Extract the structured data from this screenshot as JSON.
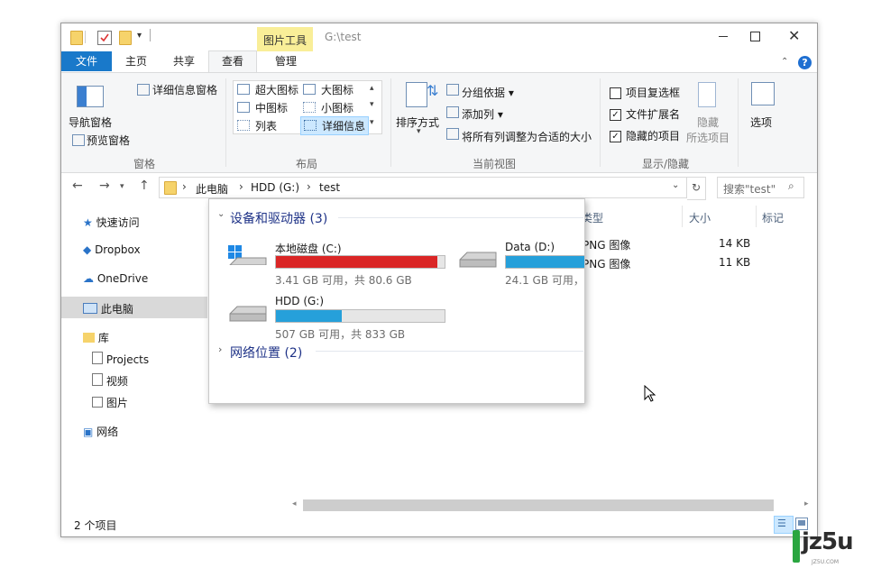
{
  "window": {
    "contextual_tab": "图片工具",
    "path_title": "G:\\test",
    "tabs": [
      "文件",
      "主页",
      "共享",
      "查看",
      "管理"
    ]
  },
  "ribbon": {
    "pane": {
      "nav_pane": "导航窗格",
      "preview_pane": "预览窗格",
      "details_pane": "详细信息窗格",
      "group": "窗格"
    },
    "layout": {
      "items": [
        "超大图标",
        "大图标",
        "中图标",
        "小图标",
        "列表",
        "详细信息"
      ],
      "group": "布局"
    },
    "current_view": {
      "sort": "排序方式",
      "group_by": "分组依据",
      "add_columns": "添加列",
      "fit_columns": "将所有列调整为合适的大小",
      "group": "当前视图"
    },
    "show_hide": {
      "item_checkboxes": "项目复选框",
      "file_extensions": "文件扩展名",
      "hidden_items": "隐藏的项目",
      "hide_selected": "隐藏",
      "hide_selected_2": "所选项目",
      "group": "显示/隐藏"
    },
    "options": "选项"
  },
  "address": {
    "crumbs": [
      "此电脑",
      "HDD (G:)",
      "test"
    ],
    "search_placeholder": "搜索\"test\""
  },
  "nav": {
    "quick_access": "快速访问",
    "dropbox": "Dropbox",
    "onedrive": "OneDrive",
    "this_pc": "此电脑",
    "libraries": "库",
    "projects": "Projects",
    "videos": "视频",
    "pictures": "图片",
    "network": "网络"
  },
  "columns": {
    "type": "类型",
    "size": "大小",
    "tags": "标记"
  },
  "files": [
    {
      "type": "PNG 图像",
      "size": "14 KB"
    },
    {
      "type": "PNG 图像",
      "size": "11 KB"
    }
  ],
  "dropdown": {
    "devices_header": "设备和驱动器 (3)",
    "network_header": "网络位置 (2)",
    "drives": [
      {
        "name": "本地磁盘 (C:)",
        "info": "3.41 GB 可用，共 80.6 GB",
        "used": 0.958,
        "color": "#da2626"
      },
      {
        "name": "Data (D:)",
        "info": "24.1 GB 可用，共",
        "used": 0.75,
        "color": "#26a0da"
      },
      {
        "name": "HDD (G:)",
        "info": "507 GB 可用，共 833 GB",
        "used": 0.39,
        "color": "#26a0da"
      }
    ]
  },
  "status": {
    "count": "2 个项目"
  },
  "watermark": {
    "text": "jz5u",
    "sub": "JZ5U.COM"
  }
}
